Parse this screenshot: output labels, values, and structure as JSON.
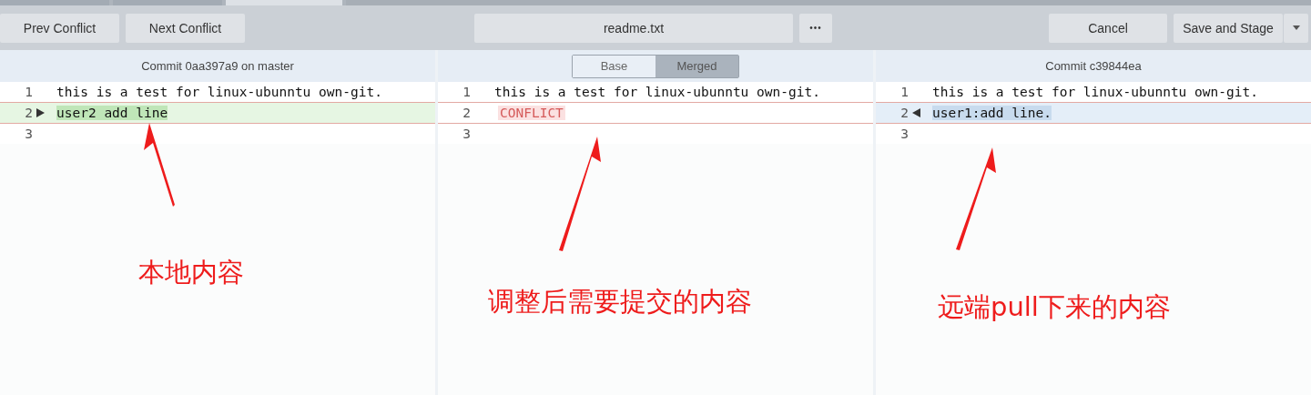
{
  "toolbar": {
    "left_buttons": [
      "Prev Conflict",
      "Next Conflict"
    ],
    "file_name": "readme.txt",
    "more_button": "•••",
    "cancel_button": "Cancel",
    "save_button": "Save and Stage"
  },
  "panes": [
    {
      "header": {
        "kind": "title",
        "title": "Commit 0aa397a9 on master"
      },
      "lines": [
        {
          "number": "1",
          "kind": "plain",
          "text": "this is a test for linux-ubunntu own-git."
        },
        {
          "number": "2",
          "kind": "local",
          "text": "user2 add line"
        },
        {
          "number": "3",
          "kind": "plain"
        }
      ],
      "annotation": {
        "text": "本地内容"
      }
    },
    {
      "header": {
        "kind": "switch",
        "options": [
          {
            "label": "Base",
            "selected": false
          },
          {
            "label": "Merged",
            "selected": true
          }
        ]
      },
      "lines": [
        {
          "number": "1",
          "kind": "plain",
          "text": "this is a test for linux-ubunntu own-git."
        },
        {
          "number": "2",
          "kind": "conflict",
          "text": "CONFLICT"
        },
        {
          "number": "3",
          "kind": "plain"
        }
      ],
      "annotation": {
        "text": "调整后需要提交的内容"
      }
    },
    {
      "header": {
        "kind": "title",
        "title": "Commit c39844ea"
      },
      "lines": [
        {
          "number": "1",
          "kind": "plain",
          "text": "this is a test for linux-ubunntu own-git."
        },
        {
          "number": "2",
          "kind": "remote",
          "text": "user1:add line."
        },
        {
          "number": "3",
          "kind": "plain"
        }
      ],
      "annotation": {
        "text": "远端pull下来的内容"
      }
    }
  ]
}
